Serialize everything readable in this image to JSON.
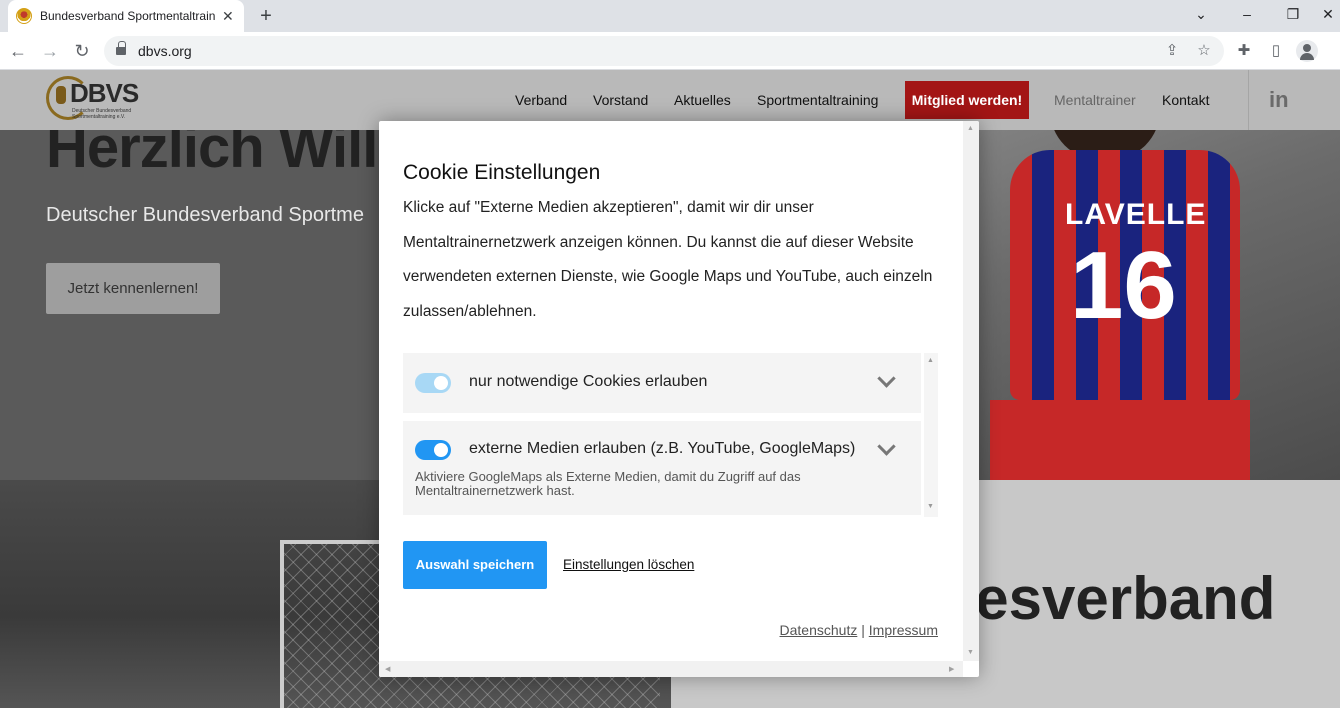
{
  "browser": {
    "tab_title": "Bundesverband Sportmentaltraining",
    "url": "dbvs.org"
  },
  "site": {
    "logo": {
      "text": "DBVS",
      "subtext": "Deutscher Bundesverband Sportmentaltraining e.V."
    },
    "nav": [
      {
        "label": "Verband"
      },
      {
        "label": "Vorstand"
      },
      {
        "label": "Aktuelles"
      },
      {
        "label": "Sportmentaltraining"
      },
      {
        "label": "Mitglied werden!"
      },
      {
        "label": "Mentaltrainer"
      },
      {
        "label": "Kontakt"
      }
    ],
    "social_icon": "linkedin-icon",
    "social_label": "in",
    "hero": {
      "title": "Herzlich Willk",
      "subtitle": "Deutscher Bundesverband Sportme",
      "button": "Jetzt kennenlernen!",
      "jersey_name": "LAVELLE",
      "jersey_number": "16"
    },
    "section_word": "Bundesverband"
  },
  "cookie_modal": {
    "title": "Cookie Einstellungen",
    "text": "Klicke auf \"Externe Medien akzeptieren\", damit wir dir unser Mentaltrainernetzwerk anzeigen können. Du kannst die auf dieser Website verwendeten externen Dienste, wie Google Maps und YouTube, auch einzeln zulassen/ablehnen.",
    "options": [
      {
        "label": "nur notwendige Cookies erlauben",
        "enabled": true,
        "locked": true
      },
      {
        "label": "externe Medien erlauben (z.B. YouTube, GoogleMaps)",
        "enabled": true,
        "locked": false,
        "description": "Aktiviere GoogleMaps als Externe Medien, damit du Zugriff auf das Mentaltrainernetzwerk hast."
      }
    ],
    "save_button": "Auswahl speichern",
    "delete_link": "Einstellungen löschen",
    "footer": {
      "privacy": "Datenschutz",
      "separator": "|",
      "imprint": "Impressum"
    }
  },
  "colors": {
    "accent": "#2196f3",
    "cta": "#a31515",
    "toggle_locked": "#a8d8f5"
  }
}
